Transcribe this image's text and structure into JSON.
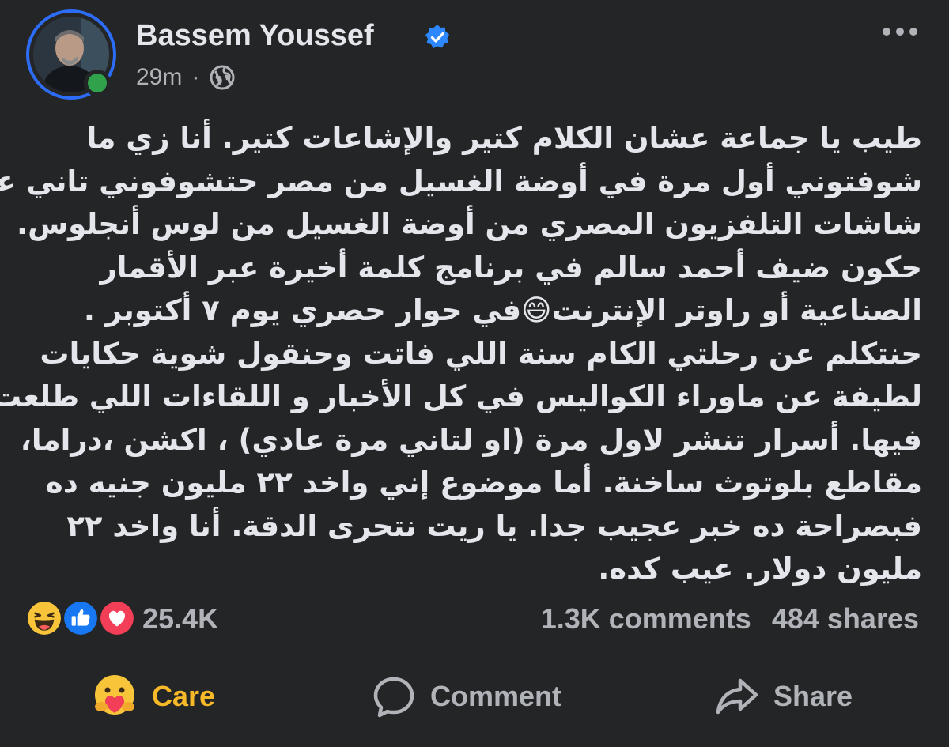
{
  "post": {
    "author": "Bassem Youssef",
    "timestamp": "29m",
    "separator": "·",
    "text_lines": [
      "طيب يا جماعة عشان الكلام كتير والإشاعات كتير. أنا زي ما",
      "شوفتوني أول مرة في أوضة الغسيل من مصر حتشوفوني تاني على",
      "شاشات التلفزيون المصري من أوضة الغسيل من لوس أنجلوس.",
      "حكون ضيف أحمد سالم في برنامج كلمة أخيرة عبر الأقمار",
      "الصناعية أو راوتر الإنترنت😄في حوار حصري يوم ٧ أكتوبر .",
      "حنتكلم عن رحلتي الكام سنة اللي فاتت وحنقول شوية حكايات",
      "لطيفة عن ماوراء الكواليس في كل الأخبار و اللقاءات اللي طلعت",
      "فيها. أسرار تنشر لاول مرة (او لتاني مرة عادي) ، اكشن ،دراما،",
      "مقاطع بلوتوث ساخنة. أما موضوع إني واخد ٢٢ مليون جنيه ده",
      "فبصراحة ده خبر عجيب جدا. يا ريت نتحرى الدقة. أنا واخد ٢٢",
      "مليون دولار. عيب كده."
    ]
  },
  "reactions": {
    "icons": [
      "haha-icon",
      "like-icon",
      "love-icon"
    ],
    "count": "25.4K"
  },
  "engagement": {
    "comments": "1.3K comments",
    "shares": "484 shares"
  },
  "actions": {
    "care": "Care",
    "comment": "Comment",
    "share": "Share"
  },
  "colors": {
    "background": "#242526",
    "text": "#e4e6eb",
    "secondary": "#b0b3b8",
    "verified": "#2d88ff",
    "online": "#31a24c",
    "care": "#f7b928"
  }
}
